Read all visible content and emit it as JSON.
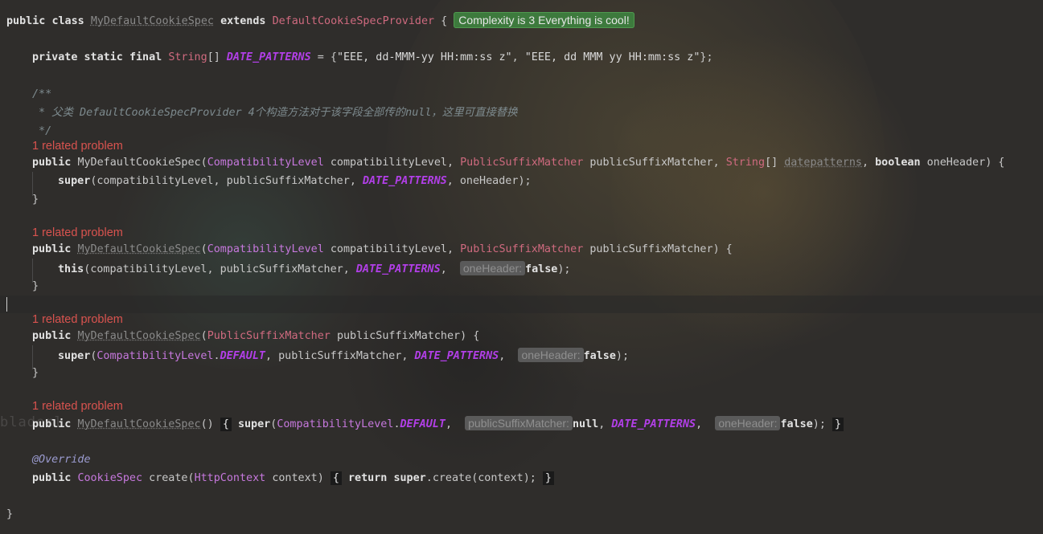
{
  "editor": {
    "complexity_badge": "Complexity is 3 Everything is cool!",
    "watermark": "bladerl"
  },
  "tokens": {
    "public": "public",
    "class": "class",
    "extends": "extends",
    "private": "private",
    "static": "static",
    "final": "final",
    "super": "super",
    "this": "this",
    "boolean": "boolean",
    "return": "return",
    "null": "null",
    "class_name": "MyDefaultCookieSpec",
    "parent_class": "DefaultCookieSpecProvider",
    "string_array_type": "String",
    "date_patterns": "DATE_PATTERNS",
    "pattern_1": "\"EEE, dd-MMM-yy HH:mm:ss z\"",
    "pattern_2": "\"EEE, dd MMM yy HH:mm:ss z\"",
    "compat_type": "CompatibilityLevel",
    "compat_param": "compatibilityLevel",
    "psm_type": "PublicSuffixMatcher",
    "psm_param": "publicSuffixMatcher",
    "datepatterns_param": "datepatterns",
    "oneheader_param": "oneHeader",
    "default_const": "DEFAULT",
    "false": "false",
    "override": "@Override",
    "cookie_spec_type": "CookieSpec",
    "create_method": "create",
    "http_context_type": "HttpContext",
    "context_param": "context"
  },
  "comment": {
    "open": "/**",
    "body": " * 父类 DefaultCookieSpecProvider 4个构造方法对于该字段全部传的null，这里可直接替换",
    "close": " */"
  },
  "problems": {
    "label": "1 related problem"
  },
  "hints": {
    "one_header": "oneHeader:",
    "public_suffix_matcher": "publicSuffixMatcher:"
  }
}
